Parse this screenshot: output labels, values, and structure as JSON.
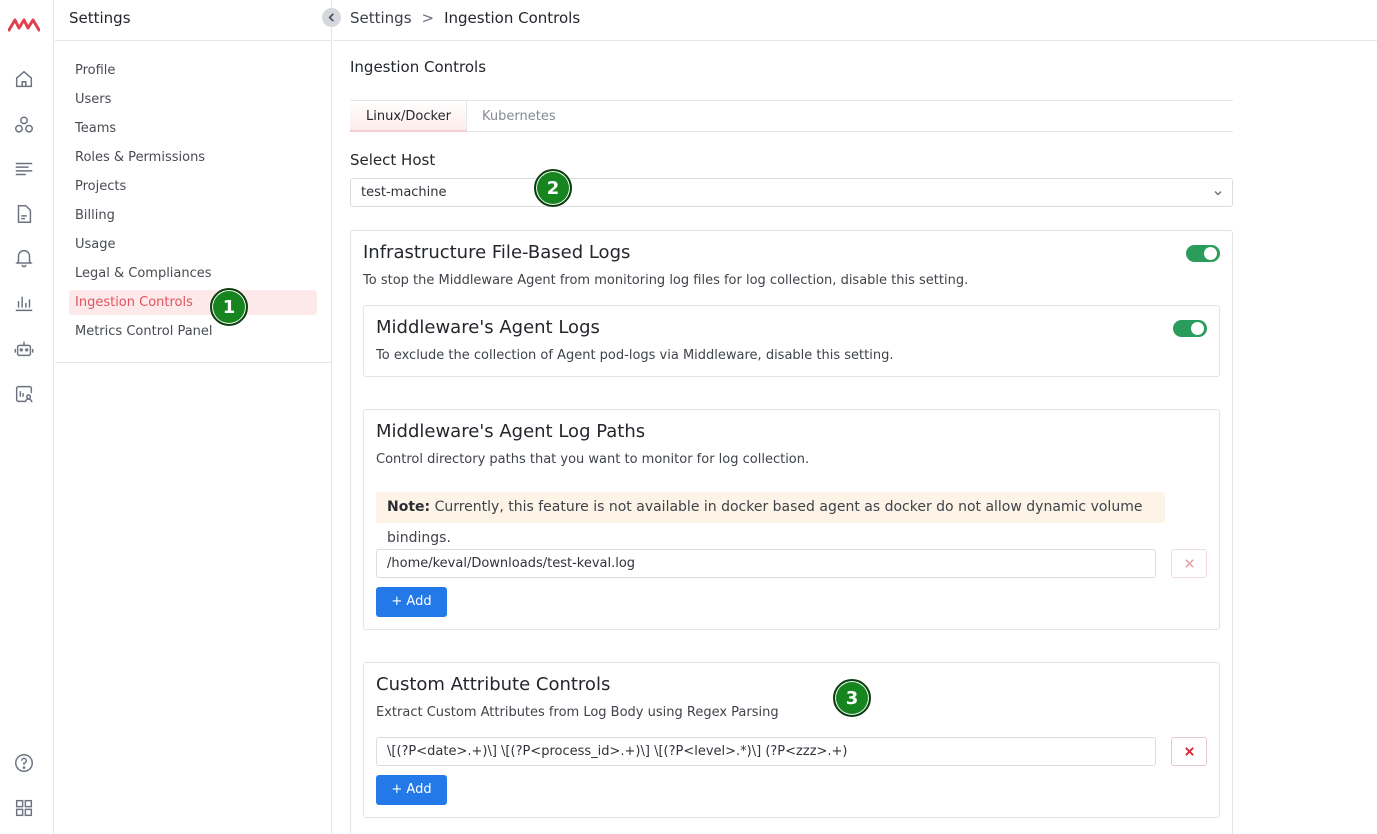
{
  "rail": {
    "icons": [
      "home-icon",
      "services-icon",
      "logs-icon",
      "document-icon",
      "bell-icon",
      "bar-chart-icon",
      "robot-icon",
      "user-monitor-icon",
      "help-icon",
      "grid-icon"
    ],
    "brand_color": "#e0414f"
  },
  "sidebar": {
    "title": "Settings",
    "items": [
      {
        "label": "Profile"
      },
      {
        "label": "Users"
      },
      {
        "label": "Teams"
      },
      {
        "label": "Roles & Permissions"
      },
      {
        "label": "Projects"
      },
      {
        "label": "Billing"
      },
      {
        "label": "Usage"
      },
      {
        "label": "Legal & Compliances"
      },
      {
        "label": "Ingestion Controls",
        "active": true
      },
      {
        "label": "Metrics Control Panel"
      }
    ]
  },
  "breadcrumb": {
    "root": "Settings",
    "separator": ">",
    "current": "Ingestion Controls"
  },
  "main": {
    "title": "Ingestion Controls",
    "tabs": [
      {
        "label": "Linux/Docker",
        "active": true
      },
      {
        "label": "Kubernetes",
        "active": false
      }
    ],
    "host": {
      "label": "Select Host",
      "value": "test-machine"
    },
    "infra_logs": {
      "title": "Infrastructure File-Based Logs",
      "description": "To stop the Middleware Agent from monitoring log files for log collection, disable this setting.",
      "enabled": true
    },
    "agent_logs": {
      "title": "Middleware's Agent Logs",
      "description": "To exclude the collection of Agent pod-logs via Middleware, disable this setting.",
      "enabled": true
    },
    "log_paths": {
      "title": "Middleware's Agent Log Paths",
      "description": "Control directory paths that you want to monitor for log collection.",
      "note_label": "Note:",
      "note_text": "Currently, this feature is not available in docker based agent as docker do not allow dynamic volume bindings.",
      "paths": [
        "/home/keval/Downloads/test-keval.log"
      ],
      "add_label": "+ Add"
    },
    "custom_attrs": {
      "title": "Custom Attribute Controls",
      "description": "Extract Custom Attributes from Log Body using Regex Parsing",
      "patterns": [
        "\\[(?P<date>.+)\\] \\[(?P<process_id>.+)\\] \\[(?P<level>.*)\\] (?P<zzz>.+)"
      ],
      "add_label": "+ Add"
    }
  },
  "annotations": {
    "badge_1": "1",
    "badge_2": "2",
    "badge_3": "3"
  },
  "colors": {
    "toggle_on": "#2a9d5c",
    "primary": "#2479e9",
    "active_item_bg": "#fde9ea",
    "active_item_text": "#e0545f",
    "note_bg": "#fdf3e6",
    "badge": "#17851f"
  }
}
